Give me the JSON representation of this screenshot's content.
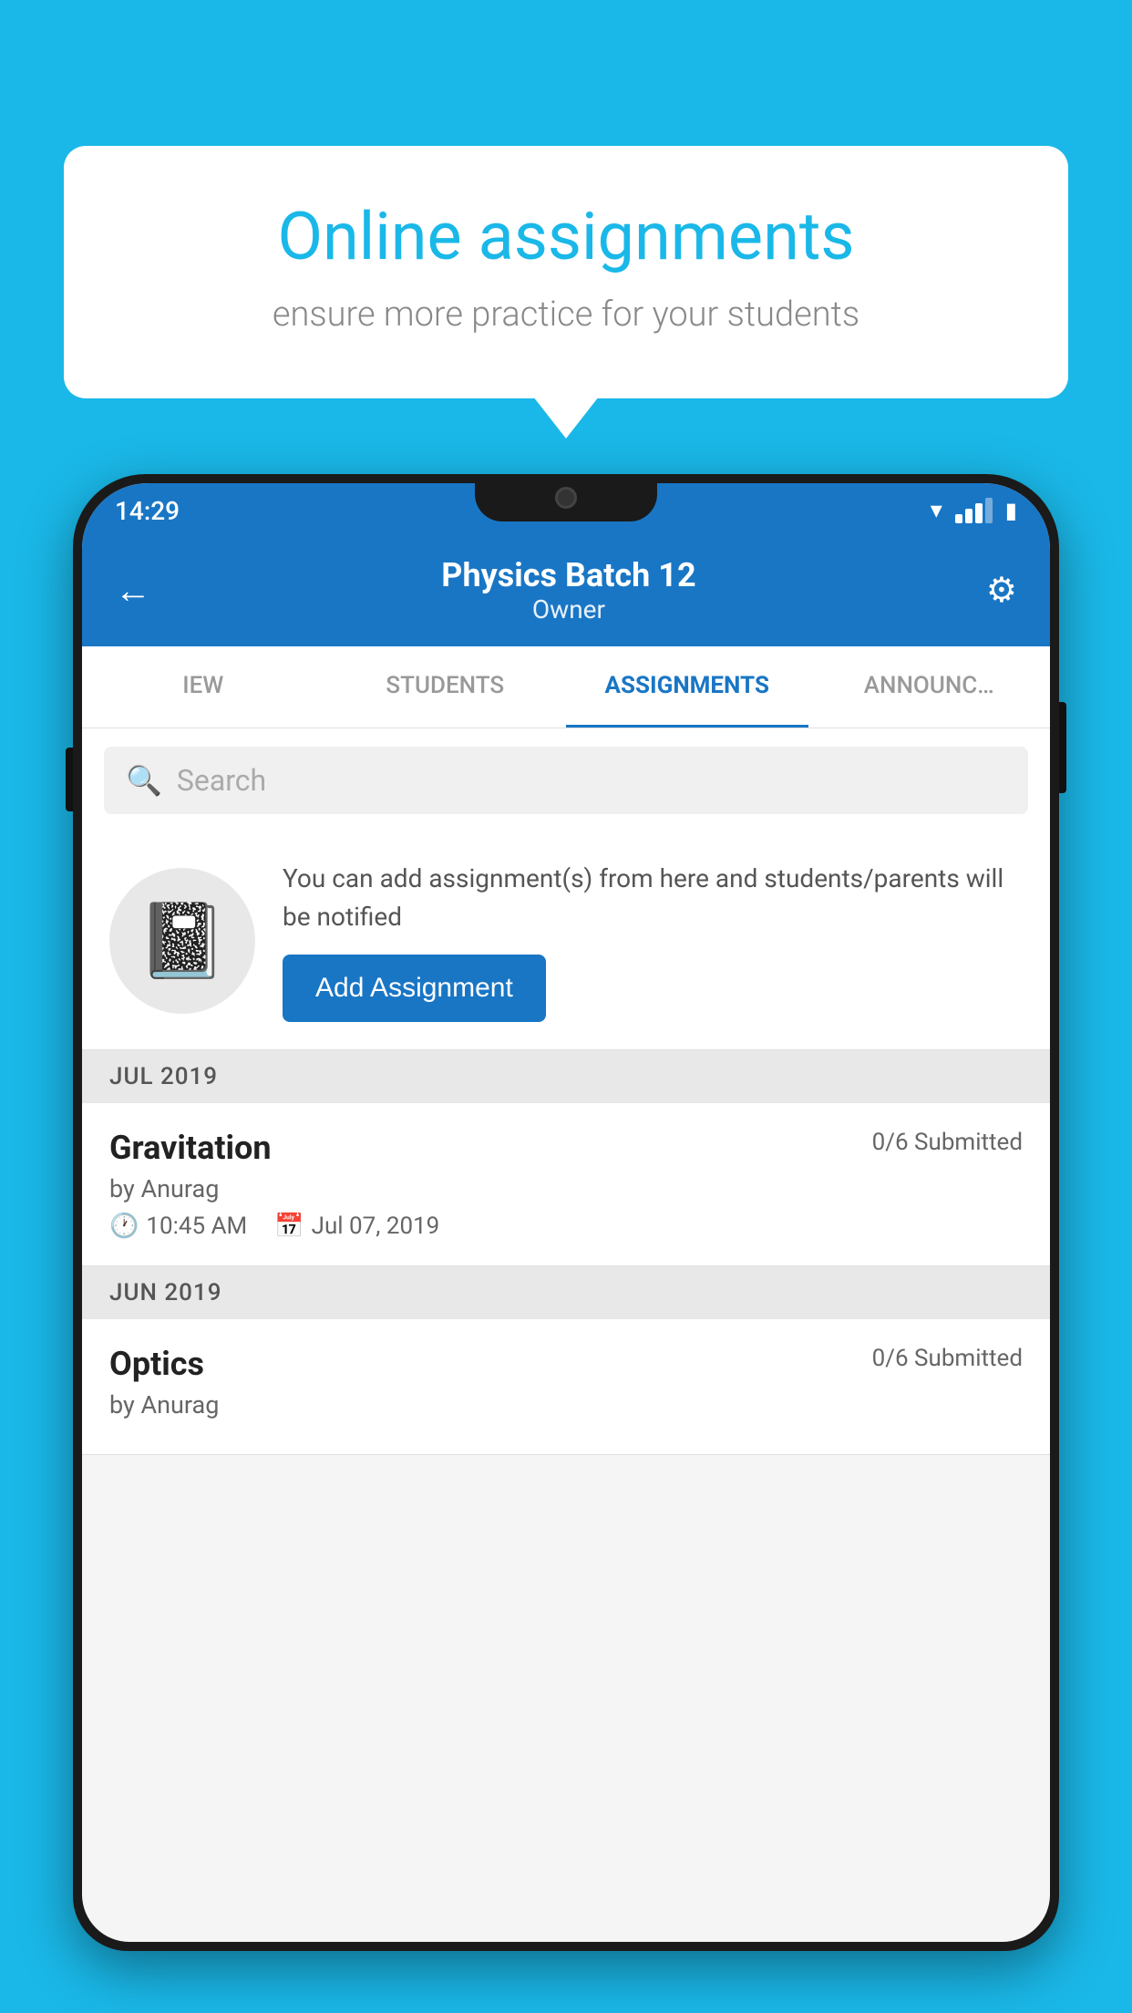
{
  "background_color": "#1ab8e8",
  "speech_bubble": {
    "title": "Online assignments",
    "subtitle": "ensure more practice for your students"
  },
  "phone": {
    "status_bar": {
      "time": "14:29"
    },
    "header": {
      "title": "Physics Batch 12",
      "subtitle": "Owner",
      "back_label": "←",
      "settings_label": "⚙"
    },
    "tabs": [
      {
        "label": "IEW",
        "active": false
      },
      {
        "label": "STUDENTS",
        "active": false
      },
      {
        "label": "ASSIGNMENTS",
        "active": true
      },
      {
        "label": "ANNOUNCEM",
        "active": false
      }
    ],
    "search": {
      "placeholder": "Search"
    },
    "promo": {
      "description": "You can add assignment(s) from here and students/parents will be notified",
      "button_label": "Add Assignment"
    },
    "sections": [
      {
        "label": "JUL 2019",
        "assignments": [
          {
            "name": "Gravitation",
            "submitted": "0/6 Submitted",
            "by": "by Anurag",
            "time": "10:45 AM",
            "date": "Jul 07, 2019"
          }
        ]
      },
      {
        "label": "JUN 2019",
        "assignments": [
          {
            "name": "Optics",
            "submitted": "0/6 Submitted",
            "by": "by Anurag",
            "time": "",
            "date": ""
          }
        ]
      }
    ]
  }
}
